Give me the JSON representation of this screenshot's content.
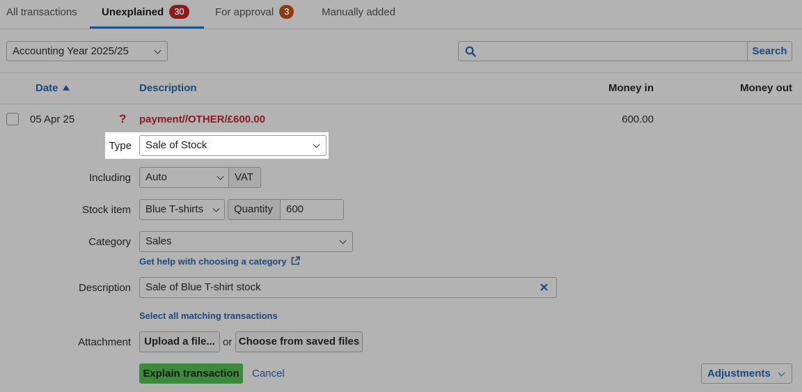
{
  "tabs": [
    {
      "label": "All transactions"
    },
    {
      "label": "Unexplained",
      "badge": "30"
    },
    {
      "label": "For approval",
      "badge": "3"
    },
    {
      "label": "Manually added"
    }
  ],
  "filter": {
    "year_label": "Accounting Year 2025/25"
  },
  "search": {
    "value": "",
    "button_label": "Search"
  },
  "table": {
    "columns": {
      "date": "Date",
      "description": "Description",
      "money_in": "Money in",
      "money_out": "Money out"
    },
    "row": {
      "date": "05 Apr 25",
      "status_icon": "?",
      "description": "payment//OTHER/£600.00",
      "money_in": "600.00",
      "money_out": ""
    }
  },
  "form": {
    "type_label": "Type",
    "type_value": "Sale of Stock",
    "including_label": "Including",
    "including_value": "Auto",
    "vat_label": "VAT",
    "stock_item_label": "Stock item",
    "stock_item_value": "Blue T-shirts",
    "quantity_label": "Quantity",
    "quantity_value": "600",
    "category_label": "Category",
    "category_value": "Sales",
    "category_help_link": "Get help with choosing a category",
    "description_label": "Description",
    "description_value": "Sale of Blue T-shirt stock",
    "select_matching_link": "Select all matching transactions",
    "attachment_label": "Attachment",
    "upload_button": "Upload a file...",
    "or_text": "or",
    "choose_saved_button": "Choose from saved files",
    "explain_button": "Explain transaction",
    "cancel_link": "Cancel",
    "adjustments_button": "Adjustments"
  },
  "colors": {
    "accent_blue": "#1b4a80",
    "badge_red": "#8c1b1b",
    "badge_orange": "#8d3a10",
    "description_red": "#8b1a1a",
    "explain_green": "#3e8a3c"
  }
}
